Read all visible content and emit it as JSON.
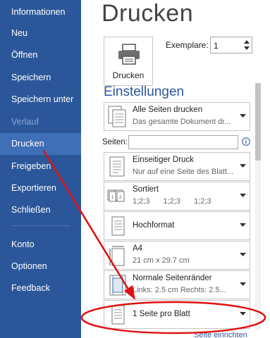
{
  "sidebar": {
    "items": [
      {
        "label": "Informationen"
      },
      {
        "label": "Neu"
      },
      {
        "label": "Öffnen"
      },
      {
        "label": "Speichern"
      },
      {
        "label": "Speichern unter"
      },
      {
        "label": "Verlauf"
      },
      {
        "label": "Drucken"
      },
      {
        "label": "Freigeben"
      },
      {
        "label": "Exportieren"
      },
      {
        "label": "Schließen"
      },
      {
        "label": "Konto"
      },
      {
        "label": "Optionen"
      },
      {
        "label": "Feedback"
      }
    ]
  },
  "main": {
    "title": "Drucken",
    "print_button_label": "Drucken",
    "copies_label": "Exemplare:",
    "copies_value": "1",
    "settings_heading": "Einstellungen",
    "pages_label": "Seiten:",
    "page_setup_link": "Seite einrichten"
  },
  "settings": [
    {
      "title": "Alle Seiten drucken",
      "subtitle": "Das gesamte Dokument dr..."
    },
    {
      "title": "Einseitiger Druck",
      "subtitle": "Nur auf eine Seite des Blatt..."
    },
    {
      "title": "Sortiert",
      "subcols": [
        "1;2;3",
        "1;2;3",
        "1;2;3"
      ]
    },
    {
      "title": "Hochformat"
    },
    {
      "title": "A4",
      "subtitle": "21 cm x 29.7 cm"
    },
    {
      "title": "Normale Seitenränder",
      "subtitle": "Links: 2.5 cm   Rechts: 2.5..."
    },
    {
      "title": "1 Seite pro Blatt"
    }
  ],
  "colors": {
    "sidebar_bg": "#2b579a",
    "sidebar_selected": "#3f6fb6",
    "annotation_red": "#e01010"
  }
}
